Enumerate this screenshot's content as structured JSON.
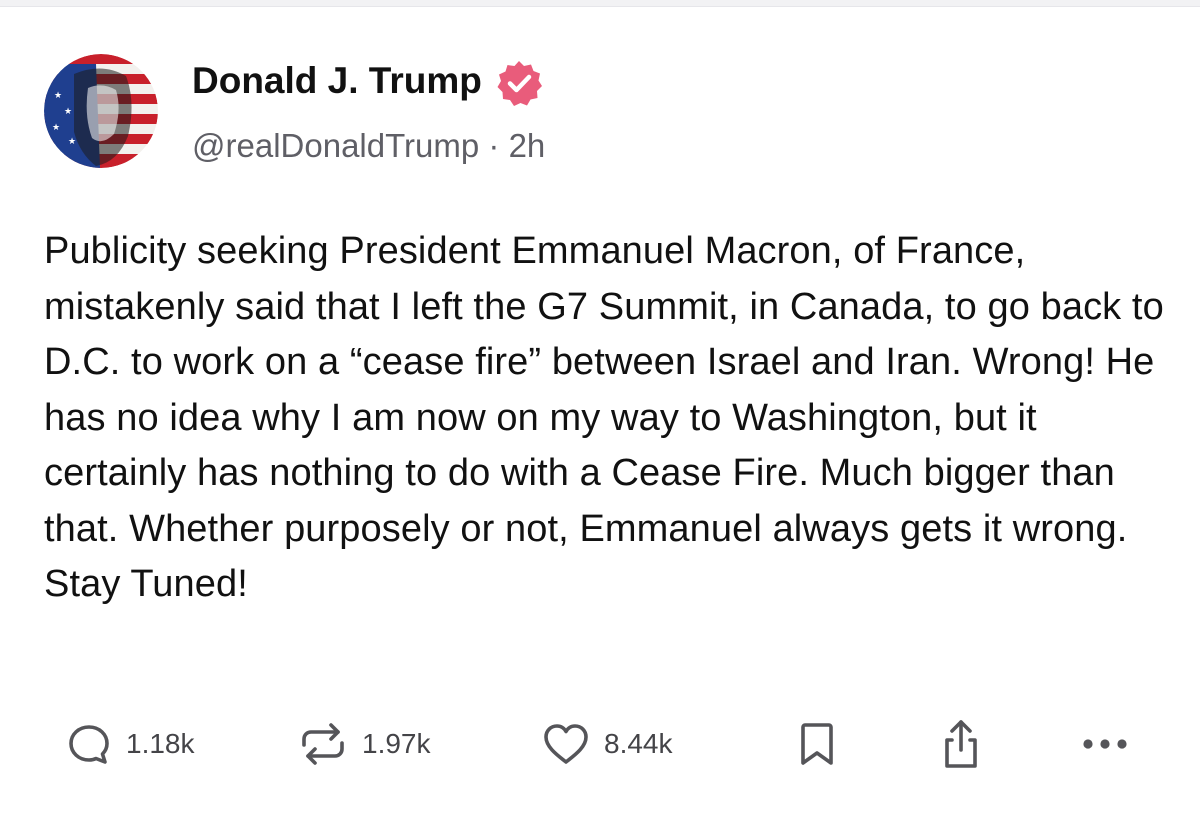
{
  "post": {
    "author": {
      "display_name": "Donald J. Trump",
      "handle": "@realDonaldTrump",
      "separator": "·",
      "timestamp": "2h",
      "verified_icon": "verified-badge-icon"
    },
    "text": "Publicity seeking President Emmanuel Macron, of France, mistakenly said that I left the G7 Summit, in Canada, to go back to D.C. to work on a “cease fire” between Israel and Iran. Wrong! He has no idea why I am now on my way to Washington, but it certainly has nothing to do with a Cease Fire. Much bigger than that. Whether purposely or not, Emmanuel always gets it wrong. Stay Tuned!"
  },
  "actions": {
    "replies": {
      "icon": "reply-icon",
      "count": "1.18k"
    },
    "retruths": {
      "icon": "retruth-icon",
      "count": "1.97k"
    },
    "likes": {
      "icon": "heart-icon",
      "count": "8.44k"
    },
    "bookmark": {
      "icon": "bookmark-icon"
    },
    "share": {
      "icon": "share-icon"
    },
    "more": {
      "icon": "more-icon"
    }
  },
  "colors": {
    "text": "#111111",
    "muted": "#5f5f66",
    "verified_badge": "#e95c7b",
    "icon": "#555559"
  }
}
